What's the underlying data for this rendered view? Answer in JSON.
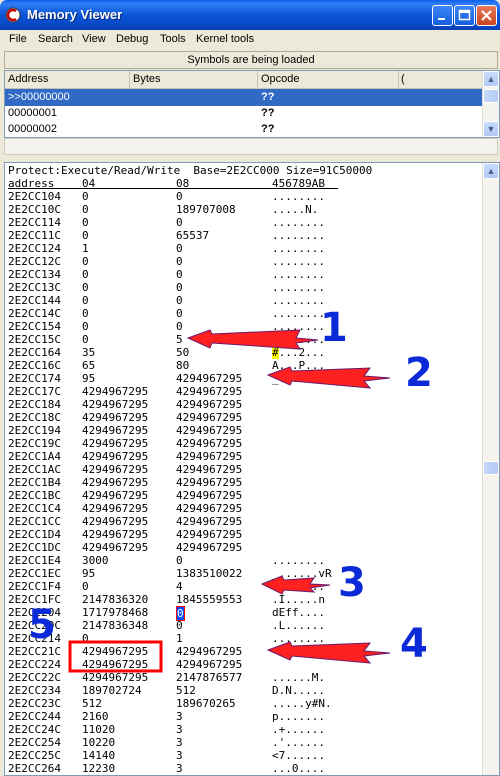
{
  "window": {
    "title": "Memory Viewer",
    "colors": {
      "titlebar": "#0a54d6",
      "selection": "#316ac5",
      "annotation_red": "#ff0000",
      "annotation_blue": "#0a2ad8"
    }
  },
  "menu": [
    "File",
    "Search",
    "View",
    "Debug",
    "Tools",
    "Kernel tools"
  ],
  "status": "Symbols are being loaded",
  "disassembler": {
    "columns": [
      "Address",
      "Bytes",
      "Opcode",
      "("
    ],
    "rows": [
      {
        "address": ">>00000000",
        "bytes": "",
        "opcode": "??",
        "selected": true
      },
      {
        "address": "00000001",
        "bytes": "",
        "opcode": "??"
      },
      {
        "address": "00000002",
        "bytes": "",
        "opcode": "??"
      }
    ]
  },
  "hexview": {
    "protect_line": "Protect:Execute/Read/Write  Base=2E2CC000 Size=91C50000",
    "header": {
      "address": "address",
      "c1": "04",
      "c2": "08",
      "c3": "456789AB"
    },
    "rows": [
      {
        "a": "2E2CC104",
        "v1": "0",
        "v2": "0",
        "t": "........"
      },
      {
        "a": "2E2CC10C",
        "v1": "0",
        "v2": "189707008",
        "t": ".....N."
      },
      {
        "a": "2E2CC114",
        "v1": "0",
        "v2": "0",
        "t": "........"
      },
      {
        "a": "2E2CC11C",
        "v1": "0",
        "v2": "65537",
        "t": "........"
      },
      {
        "a": "2E2CC124",
        "v1": "1",
        "v2": "0",
        "t": "........"
      },
      {
        "a": "2E2CC12C",
        "v1": "0",
        "v2": "0",
        "t": "........"
      },
      {
        "a": "2E2CC134",
        "v1": "0",
        "v2": "0",
        "t": "........"
      },
      {
        "a": "2E2CC13C",
        "v1": "0",
        "v2": "0",
        "t": "........"
      },
      {
        "a": "2E2CC144",
        "v1": "0",
        "v2": "0",
        "t": "........"
      },
      {
        "a": "2E2CC14C",
        "v1": "0",
        "v2": "0",
        "t": "........"
      },
      {
        "a": "2E2CC154",
        "v1": "0",
        "v2": "0",
        "t": "........"
      },
      {
        "a": "2E2CC15C",
        "v1": "0",
        "v2": "5",
        "t": "........"
      },
      {
        "a": "2E2CC164",
        "v1": "35",
        "v2": "50",
        "t": "#...2..."
      },
      {
        "a": "2E2CC16C",
        "v1": "65",
        "v2": "80",
        "t": "A...P..."
      },
      {
        "a": "2E2CC174",
        "v1": "95",
        "v2": "4294967295",
        "t": "_......."
      },
      {
        "a": "2E2CC17C",
        "v1": "4294967295",
        "v2": "4294967295",
        "t": ""
      },
      {
        "a": "2E2CC184",
        "v1": "4294967295",
        "v2": "4294967295",
        "t": ""
      },
      {
        "a": "2E2CC18C",
        "v1": "4294967295",
        "v2": "4294967295",
        "t": ""
      },
      {
        "a": "2E2CC194",
        "v1": "4294967295",
        "v2": "4294967295",
        "t": ""
      },
      {
        "a": "2E2CC19C",
        "v1": "4294967295",
        "v2": "4294967295",
        "t": ""
      },
      {
        "a": "2E2CC1A4",
        "v1": "4294967295",
        "v2": "4294967295",
        "t": ""
      },
      {
        "a": "2E2CC1AC",
        "v1": "4294967295",
        "v2": "4294967295",
        "t": ""
      },
      {
        "a": "2E2CC1B4",
        "v1": "4294967295",
        "v2": "4294967295",
        "t": ""
      },
      {
        "a": "2E2CC1BC",
        "v1": "4294967295",
        "v2": "4294967295",
        "t": ""
      },
      {
        "a": "2E2CC1C4",
        "v1": "4294967295",
        "v2": "4294967295",
        "t": ""
      },
      {
        "a": "2E2CC1CC",
        "v1": "4294967295",
        "v2": "4294967295",
        "t": ""
      },
      {
        "a": "2E2CC1D4",
        "v1": "4294967295",
        "v2": "4294967295",
        "t": ""
      },
      {
        "a": "2E2CC1DC",
        "v1": "4294967295",
        "v2": "4294967295",
        "t": ""
      },
      {
        "a": "2E2CC1E4",
        "v1": "3000",
        "v2": "0",
        "t": "........"
      },
      {
        "a": "2E2CC1EC",
        "v1": "95",
        "v2": "1383510022",
        "t": "_......vR"
      },
      {
        "a": "2E2CC1F4",
        "v1": "0",
        "v2": "4",
        "t": "........"
      },
      {
        "a": "2E2CC1FC",
        "v1": "2147836320",
        "v2": "1845559553",
        "t": ".I.....n"
      },
      {
        "a": "2E2CC204",
        "v1": "1717978468",
        "v2": "0",
        "t": "dEff...."
      },
      {
        "a": "2E2CC20C",
        "v1": "2147836348",
        "v2": "0",
        "t": ".L......"
      },
      {
        "a": "2E2CC214",
        "v1": "0",
        "v2": "1",
        "t": "........"
      },
      {
        "a": "2E2CC21C",
        "v1": "4294967295",
        "v2": "4294967295",
        "t": ""
      },
      {
        "a": "2E2CC224",
        "v1": "4294967295",
        "v2": "4294967295",
        "t": ""
      },
      {
        "a": "2E2CC22C",
        "v1": "4294967295",
        "v2": "2147876577",
        "t": "......M."
      },
      {
        "a": "2E2CC234",
        "v1": "189702724",
        "v2": "512",
        "t": "D.N....."
      },
      {
        "a": "2E2CC23C",
        "v1": "512",
        "v2": "189670265",
        "t": ".....y#N."
      },
      {
        "a": "2E2CC244",
        "v1": "2160",
        "v2": "3",
        "t": "p......."
      },
      {
        "a": "2E2CC24C",
        "v1": "11020",
        "v2": "3",
        "t": ".+......"
      },
      {
        "a": "2E2CC254",
        "v1": "10220",
        "v2": "3",
        "t": ".'......"
      },
      {
        "a": "2E2CC25C",
        "v1": "14140",
        "v2": "3",
        "t": "<7......"
      },
      {
        "a": "2E2CC264",
        "v1": "12230",
        "v2": "3",
        "t": "...0...."
      }
    ]
  },
  "annotations": [
    "1",
    "2",
    "3",
    "4",
    "5"
  ]
}
